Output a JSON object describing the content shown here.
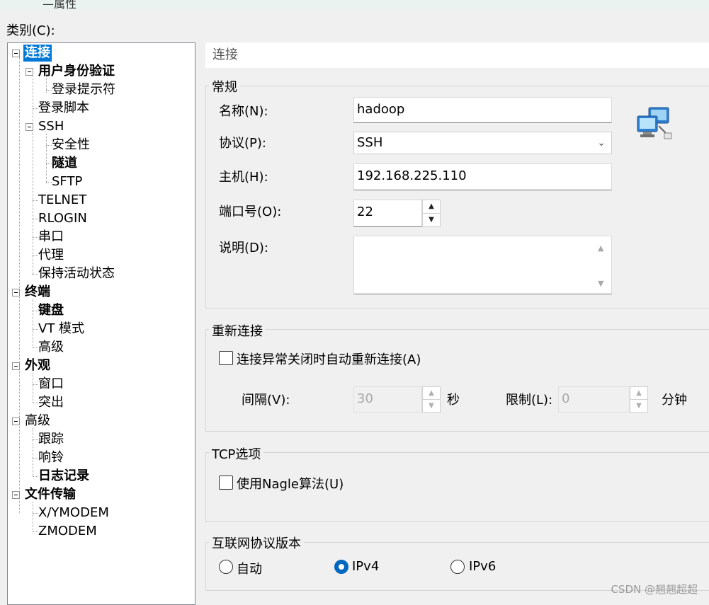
{
  "window": {
    "title_fragment": "—属性"
  },
  "category_label": "类别(C):",
  "tree": [
    {
      "label": "连接",
      "bold": true,
      "selected": true
    },
    {
      "label": "用户身份验证",
      "bold": true
    },
    {
      "label": "登录提示符"
    },
    {
      "label": "登录脚本"
    },
    {
      "label": "SSH"
    },
    {
      "label": "安全性"
    },
    {
      "label": "隧道",
      "bold": true
    },
    {
      "label": "SFTP"
    },
    {
      "label": "TELNET"
    },
    {
      "label": "RLOGIN"
    },
    {
      "label": "串口"
    },
    {
      "label": "代理"
    },
    {
      "label": "保持活动状态"
    },
    {
      "label": "终端",
      "bold": true
    },
    {
      "label": "键盘",
      "bold": true
    },
    {
      "label": "VT 模式"
    },
    {
      "label": "高级"
    },
    {
      "label": "外观",
      "bold": true
    },
    {
      "label": "窗口"
    },
    {
      "label": "突出"
    },
    {
      "label": "高级"
    },
    {
      "label": "跟踪"
    },
    {
      "label": "响铃"
    },
    {
      "label": "日志记录",
      "bold": true
    },
    {
      "label": "文件传输",
      "bold": true
    },
    {
      "label": "X/YMODEM"
    },
    {
      "label": "ZMODEM"
    }
  ],
  "panel_title": "连接",
  "general": {
    "title": "常规",
    "name_label": "名称(N):",
    "name_value": "hadoop",
    "protocol_label": "协议(P):",
    "protocol_value": "SSH",
    "host_label": "主机(H):",
    "host_value": "192.168.225.110",
    "port_label": "端口号(O):",
    "port_value": "22",
    "desc_label": "说明(D):",
    "desc_value": ""
  },
  "reconnect": {
    "title": "重新连接",
    "checkbox_label": "连接异常关闭时自动重新连接(A)",
    "checked": false,
    "interval_label": "间隔(V):",
    "interval_value": "30",
    "interval_unit": "秒",
    "limit_label": "限制(L):",
    "limit_value": "0",
    "limit_unit": "分钟"
  },
  "tcp": {
    "title": "TCP选项",
    "nagle_label": "使用Nagle算法(U)",
    "checked": false
  },
  "ip_version": {
    "title": "互联网协议版本",
    "options": [
      "自动",
      "IPv4",
      "IPv6"
    ],
    "selected": "IPv4"
  },
  "watermark": "CSDN @翘翘超超",
  "colors": {
    "selection": "#0078d7",
    "radio_selected": "#0067c0"
  },
  "icons": {
    "connection": "network-computers-icon"
  }
}
